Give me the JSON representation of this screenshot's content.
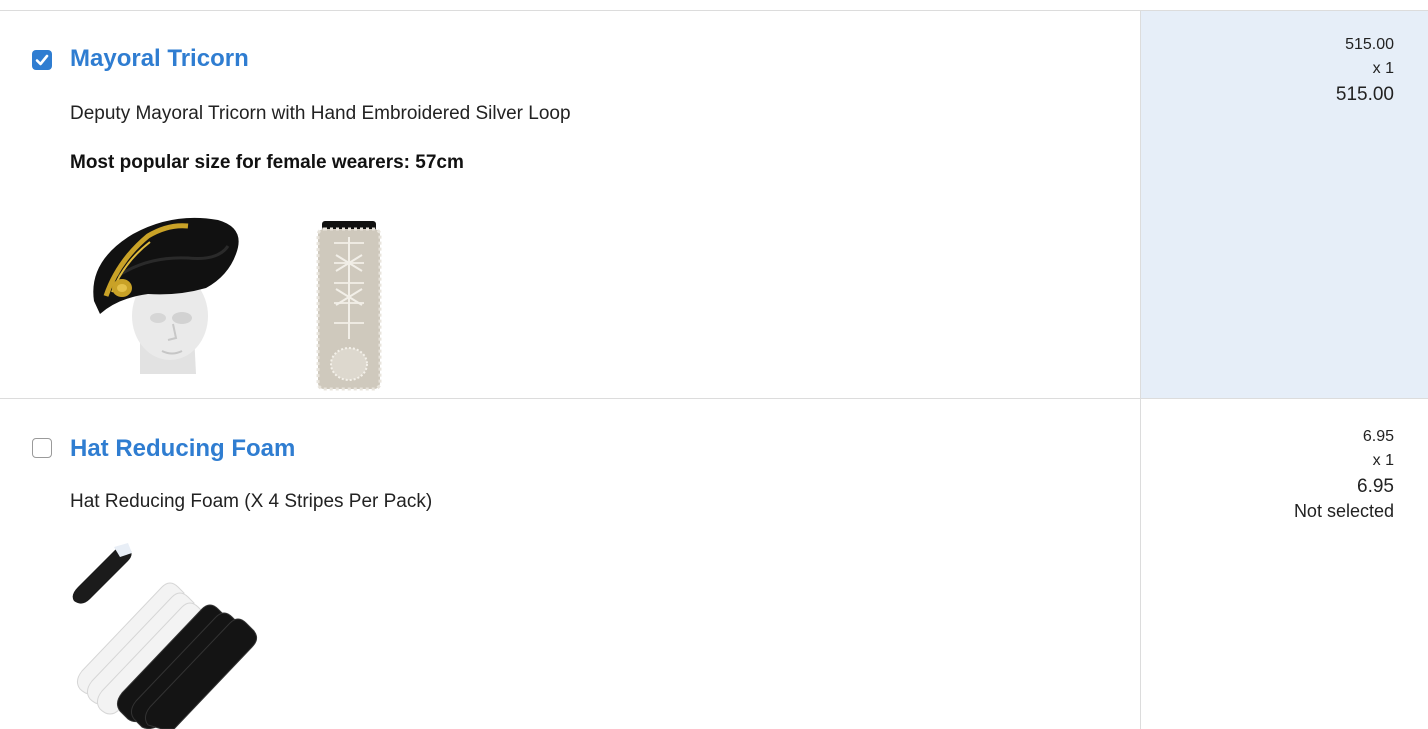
{
  "items": [
    {
      "name": "Mayoral Tricorn",
      "checked": true,
      "description": "Deputy Mayoral Tricorn with Hand Embroidered Silver Loop",
      "note": "Most popular size for female wearers: 57cm",
      "unit_price": "515.00",
      "quantity": "x 1",
      "total": "515.00",
      "images": [
        "tricorn-hat-on-mannequin",
        "embroidered-silver-loop"
      ]
    },
    {
      "name": "Hat Reducing Foam",
      "checked": false,
      "description": "Hat Reducing Foam (X 4 Stripes Per Pack)",
      "unit_price": "6.95",
      "quantity": "x 1",
      "total": "6.95",
      "status": "Not selected",
      "images": [
        "foam-strips-pack"
      ]
    }
  ],
  "colors": {
    "link": "#2f7dd1",
    "selected_bg": "#e6eef8",
    "divider": "#dcdcdc"
  }
}
